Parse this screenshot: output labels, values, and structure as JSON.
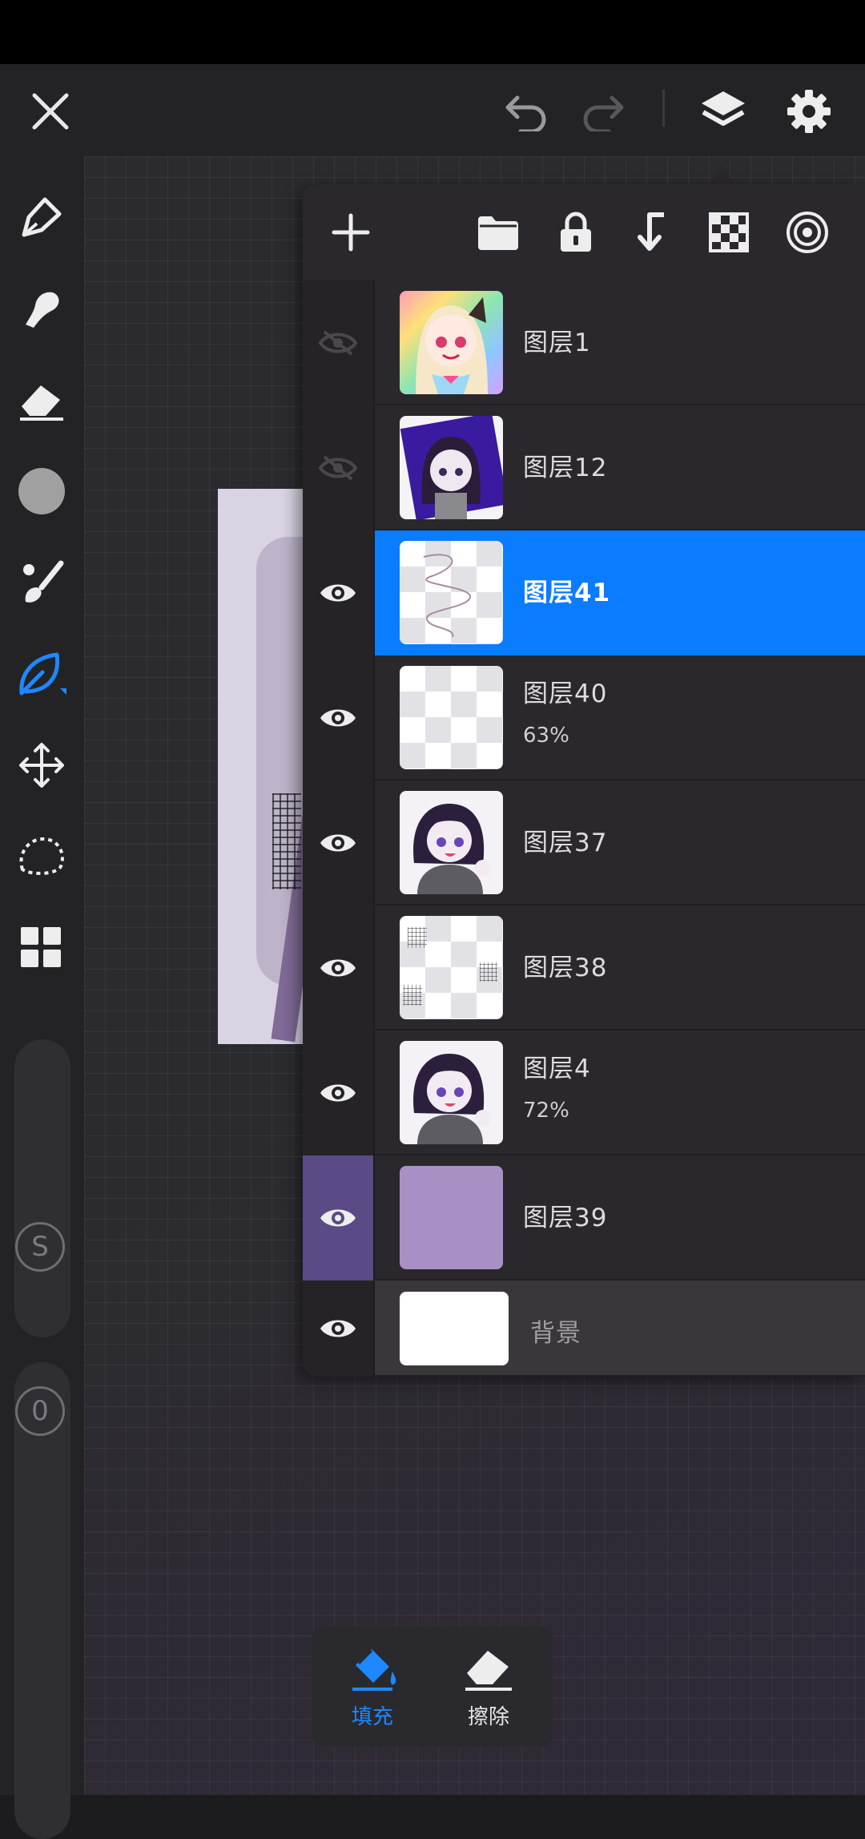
{
  "topbar": {
    "close_icon": "close-icon",
    "undo_icon": "undo-icon",
    "redo_icon": "redo-icon",
    "layers_icon": "layers-icon",
    "settings_icon": "gear-icon"
  },
  "tools": [
    {
      "name": "pen-tool",
      "icon": "pen-icon"
    },
    {
      "name": "smudge-tool",
      "icon": "smudge-icon"
    },
    {
      "name": "eraser-tool",
      "icon": "eraser-icon"
    },
    {
      "name": "color-picker",
      "icon": "color-dot-icon",
      "color": "#a0a0a0"
    },
    {
      "name": "brush-tool",
      "icon": "brush-icon"
    },
    {
      "name": "fill-tool",
      "icon": "leaf-icon",
      "active": true
    },
    {
      "name": "move-tool",
      "icon": "move-icon"
    },
    {
      "name": "lasso-tool",
      "icon": "lasso-icon"
    },
    {
      "name": "grid-tool",
      "icon": "grid-icon"
    }
  ],
  "sliders": {
    "size_label": "S",
    "opacity_label": "0"
  },
  "layer_panel": {
    "toolbar": [
      "add-icon",
      "folder-icon",
      "lock-icon",
      "clip-icon",
      "checker-icon",
      "target-icon"
    ],
    "layers": [
      {
        "name": "图层1",
        "visible": false,
        "thumb": "character-rainbow",
        "opacity": ""
      },
      {
        "name": "图层12",
        "visible": false,
        "thumb": "character-purple",
        "opacity": ""
      },
      {
        "name": "图层41",
        "visible": true,
        "thumb": "scribble",
        "opacity": "",
        "selected": true
      },
      {
        "name": "图层40",
        "visible": true,
        "thumb": "empty",
        "opacity": "63%"
      },
      {
        "name": "图层37",
        "visible": true,
        "thumb": "character-waving",
        "opacity": ""
      },
      {
        "name": "图层38",
        "visible": true,
        "thumb": "hatch",
        "opacity": ""
      },
      {
        "name": "图层4",
        "visible": true,
        "thumb": "character-waving",
        "opacity": "72%"
      },
      {
        "name": "图层39",
        "visible": true,
        "thumb": "solid-lilac",
        "opacity": "",
        "clip_base": true
      },
      {
        "name": "背景",
        "visible": true,
        "thumb": "white",
        "opacity": ""
      }
    ]
  },
  "bottom_popup": {
    "fill_label": "填充",
    "erase_label": "擦除"
  },
  "colors": {
    "accent": "#0a7cff",
    "panel": "#2a282c",
    "clip_base": "#5a4a86",
    "lilac": "#a990c4"
  }
}
